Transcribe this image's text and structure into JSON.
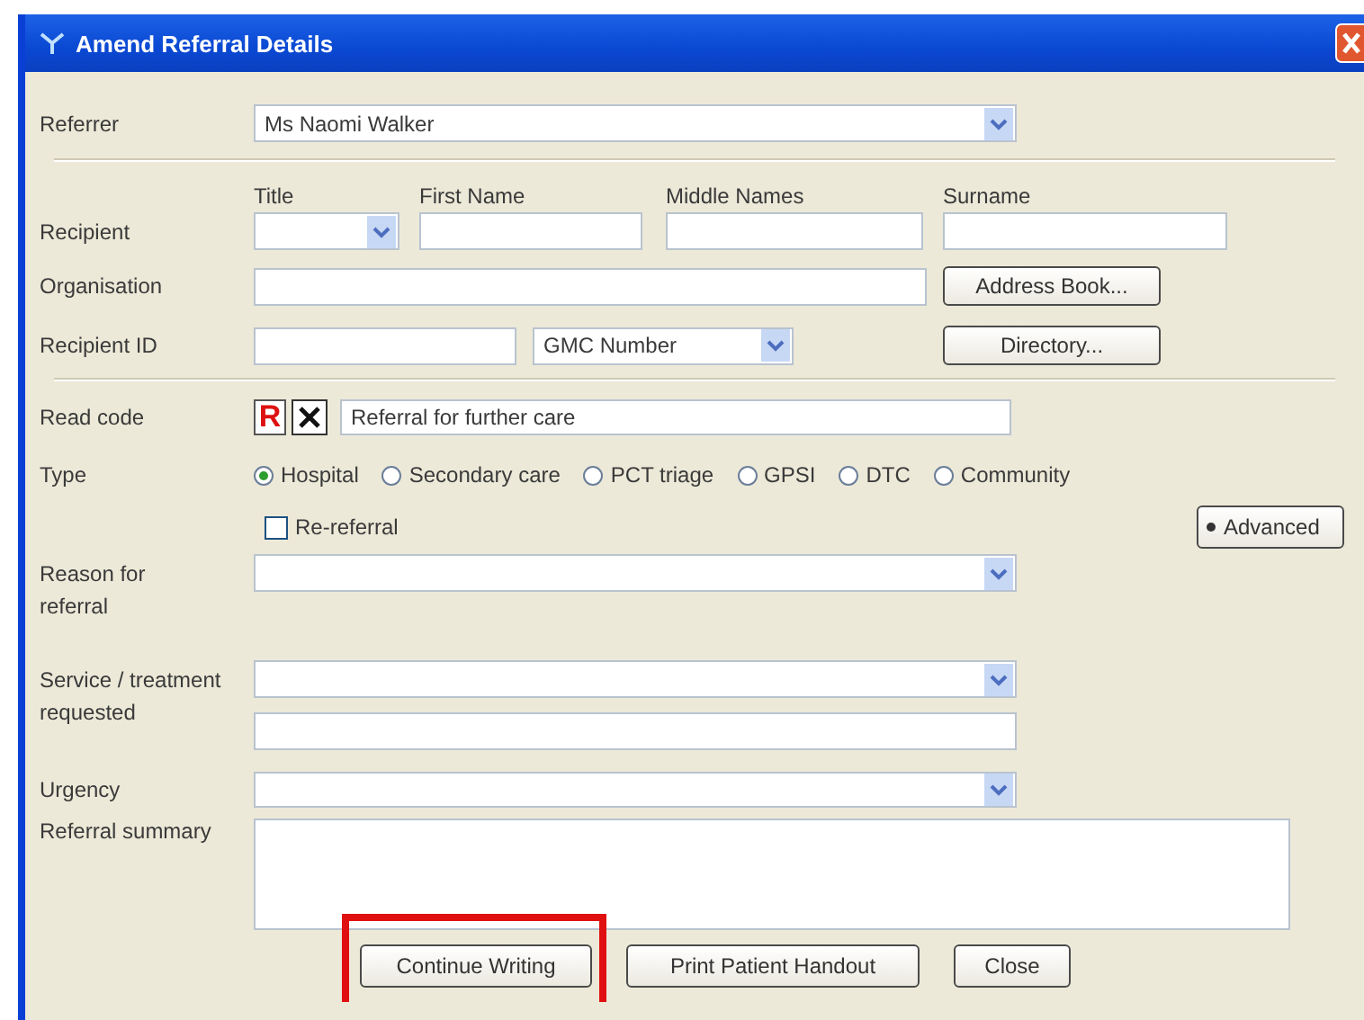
{
  "window": {
    "title": "Amend Referral Details"
  },
  "referrer": {
    "label": "Referrer",
    "value": "Ms Naomi Walker"
  },
  "recipient": {
    "label": "Recipient",
    "columns": [
      "Title",
      "First Name",
      "Middle Names",
      "Surname"
    ]
  },
  "organisation": {
    "label": "Organisation",
    "button": "Address Book..."
  },
  "recipient_id": {
    "label": "Recipient ID",
    "id_type": "GMC Number",
    "button": "Directory..."
  },
  "read_code": {
    "label": "Read code",
    "badge": "R",
    "value": "Referral for further care"
  },
  "type": {
    "label": "Type",
    "options": [
      {
        "label": "Hospital",
        "selected": true
      },
      {
        "label": "Secondary care",
        "selected": false
      },
      {
        "label": "PCT triage",
        "selected": false
      },
      {
        "label": "GPSI",
        "selected": false
      },
      {
        "label": "DTC",
        "selected": false
      },
      {
        "label": "Community",
        "selected": false
      }
    ]
  },
  "re_referral": {
    "label": "Re-referral",
    "checked": false
  },
  "advanced_button": "Advanced",
  "reason": {
    "label": "Reason for referral"
  },
  "service": {
    "label": "Service / treatment requested"
  },
  "urgency": {
    "label": "Urgency"
  },
  "summary": {
    "label": "Referral summary"
  },
  "buttons": [
    {
      "label": "Continue Writing",
      "highlighted": true
    },
    {
      "label": "Print Patient Handout",
      "highlighted": false
    },
    {
      "label": "Close",
      "highlighted": false
    }
  ]
}
